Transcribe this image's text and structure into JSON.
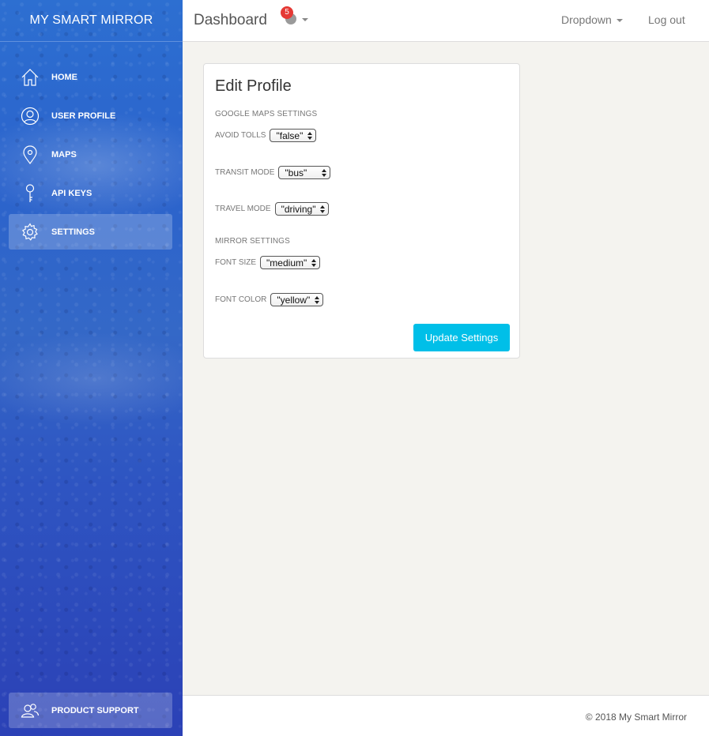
{
  "sidebar": {
    "brand": "MY SMART MIRROR",
    "items": [
      {
        "label": "HOME",
        "icon": "home-icon"
      },
      {
        "label": "USER PROFILE",
        "icon": "user-icon"
      },
      {
        "label": "MAPS",
        "icon": "map-pin-icon"
      },
      {
        "label": "API KEYS",
        "icon": "key-icon"
      },
      {
        "label": "SETTINGS",
        "icon": "gear-icon",
        "active": true
      }
    ],
    "support": {
      "label": "PRODUCT SUPPORT",
      "icon": "users-icon"
    }
  },
  "header": {
    "title": "Dashboard",
    "notification_count": "5",
    "notification_icon": "globe-icon",
    "dropdown_label": "Dropdown",
    "logout_label": "Log out"
  },
  "card": {
    "title": "Edit Profile",
    "google_maps_section": "GOOGLE MAPS SETTINGS",
    "mirror_section": "MIRROR SETTINGS",
    "fields": {
      "avoid_tolls": {
        "label": "AVOID TOLLS",
        "value": "\"false\""
      },
      "transit_mode": {
        "label": "TRANSIT MODE",
        "value": "\"bus\""
      },
      "travel_mode": {
        "label": "TRAVEL MODE",
        "value": "\"driving\""
      },
      "font_size": {
        "label": "FONT SIZE",
        "value": "\"medium\""
      },
      "font_color": {
        "label": "FONT COLOR",
        "value": "\"yellow\""
      }
    },
    "button_label": "Update Settings"
  },
  "footer": {
    "copyright": "© 2018 My Smart Mirror"
  },
  "colors": {
    "accent": "#00bfe8",
    "badge": "#e53935",
    "sidebar": "#2d5fcc"
  }
}
